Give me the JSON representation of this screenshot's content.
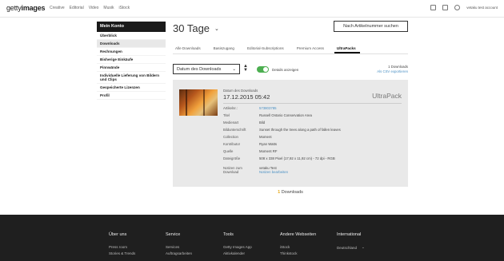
{
  "header": {
    "logo_regular": "getty",
    "logo_bold": "images",
    "nav": [
      "Creative",
      "Editorial",
      "Video",
      "Musik",
      "iStock"
    ],
    "account": "vetaku test account"
  },
  "sidebar": {
    "title": "Mein Konto",
    "items": [
      {
        "label": "Überblick",
        "active": false
      },
      {
        "label": "Downloads",
        "active": true
      },
      {
        "label": "Rechnungen",
        "active": false
      },
      {
        "label": "Bisherige Einkäufe",
        "active": false
      },
      {
        "label": "Pinnwände",
        "active": false
      },
      {
        "label": "Individuelle Lieferung von Bildern und Clips",
        "active": false
      },
      {
        "label": "Gespeicherte Lizenzen",
        "active": false
      },
      {
        "label": "Profil",
        "active": false
      }
    ]
  },
  "main": {
    "title": "30 Tage",
    "search_button": "Nach Artikelnummer suchen",
    "tabs": [
      {
        "label": "Alle Downloads",
        "active": false
      },
      {
        "label": "Basiszugang",
        "active": false
      },
      {
        "label": "Editorial-Subscriptions",
        "active": false
      },
      {
        "label": "Premium Access",
        "active": false
      },
      {
        "label": "UltraPacks",
        "active": true
      }
    ],
    "sort_label": "Datum des Downloads",
    "details_label": "Details anzeigen",
    "downloads_count": "1 Downloads",
    "csv_label": "Als CSV exportieren"
  },
  "card": {
    "date_label": "Datum des Downloads",
    "date": "17.12.2015 05:42",
    "brand": "UltraPack",
    "rows": [
      {
        "k": "Artikelnr.:",
        "v": "573803785",
        "link": true
      },
      {
        "k": "Titel",
        "v": "Russell Ontario Conservation Area",
        "link": false
      },
      {
        "k": "Medienart",
        "v": "Bild",
        "link": false
      },
      {
        "k": "Bildunterschrift",
        "v": "Sunset through the trees along a path of fallen leaves",
        "link": false
      },
      {
        "k": "Collection",
        "v": "Moment",
        "link": false
      },
      {
        "k": "Kontributor",
        "v": "Ryan Watts",
        "link": false
      },
      {
        "k": "Quelle",
        "v": "Moment RF",
        "link": false
      },
      {
        "k": "Dateigröße",
        "v": "508 x 338 Pixel (17,92 x 11,92 cm) - 72 dpi - RGB",
        "link": false
      }
    ],
    "notes_label_1": "Notizen zum",
    "notes_label_2": "Download",
    "notes_value": "vetaku Test",
    "notes_edit": "Notizen bearbeiten"
  },
  "summary": {
    "count": "1",
    "label": "Downloads"
  },
  "footer": {
    "columns": [
      {
        "title": "Über uns",
        "items": [
          "Press room",
          "Stories & Trends"
        ]
      },
      {
        "title": "Service",
        "items": [
          "Services",
          "Auftragsarbeiten"
        ]
      },
      {
        "title": "Tools",
        "items": [
          "Getty Images App",
          "Aktivkalender"
        ]
      },
      {
        "title": "Andere Webseiten",
        "items": [
          "iStock",
          "Thinkstock"
        ]
      },
      {
        "title": "International",
        "items": []
      }
    ],
    "country": "Deutschland"
  }
}
